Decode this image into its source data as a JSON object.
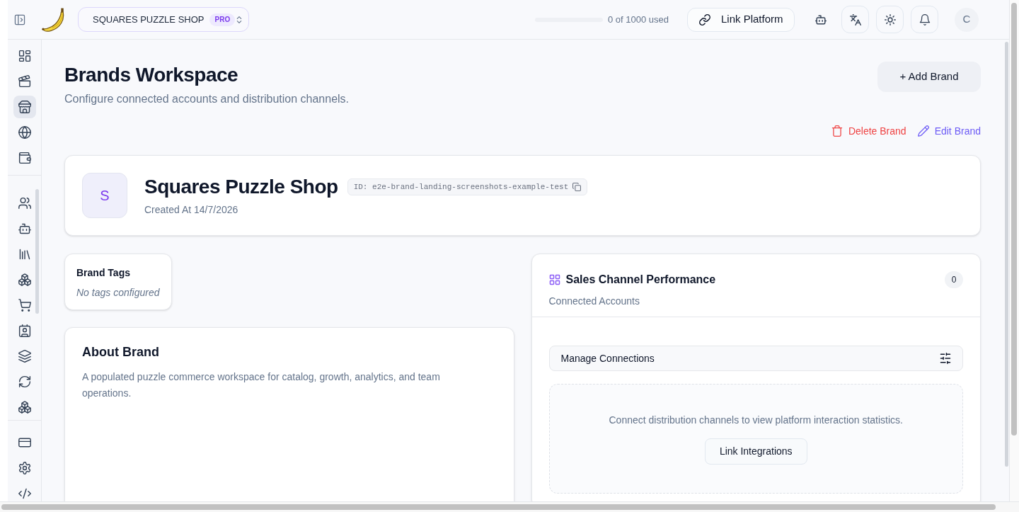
{
  "topbar": {
    "workspace": {
      "name": "SQUARES PUZZLE SHOP",
      "badge": "PRO"
    },
    "usage": {
      "level": 0,
      "text": "0 of 1000 used"
    },
    "link_button": "Link Platform",
    "avatar": "C"
  },
  "sidebar": {
    "sections": [
      {
        "items": [
          {
            "selected": false
          },
          {
            "selected": false
          },
          {
            "selected": true
          },
          {
            "selected": false
          },
          {
            "selected": false
          }
        ]
      },
      {
        "items": [
          {
            "selected": false
          },
          {
            "selected": false
          },
          {
            "selected": false
          },
          {
            "selected": false
          },
          {
            "selected": false
          },
          {
            "selected": false
          },
          {
            "selected": false
          },
          {
            "selected": false
          },
          {
            "selected": false
          }
        ]
      },
      {
        "items": [
          {
            "selected": false
          },
          {
            "selected": false
          },
          {
            "selected": false
          }
        ]
      }
    ]
  },
  "header": {
    "title": "Brands Workspace",
    "subtitle": "Configure connected accounts and distribution channels.",
    "add_button": "+ Add Brand"
  },
  "actions": [
    {
      "kind": "delete",
      "label": "Delete Brand"
    },
    {
      "kind": "edit",
      "label": "Edit Brand"
    }
  ],
  "brand": {
    "initial": "S",
    "name": "Squares Puzzle Shop",
    "id": "ID: e2e-brand-landing-screenshots-example-test",
    "created": "Created At 14/7/2026"
  },
  "tags": {
    "title": "Brand Tags",
    "empty_text": "No tags configured"
  },
  "about": {
    "title": "About Brand",
    "text": "A populated puzzle commerce workspace for catalog, growth, analytics, and team operations."
  },
  "sales": {
    "title": "Sales Channel Performance",
    "count": "0",
    "subtitle": "Connected Accounts",
    "manage_label": "Manage Connections",
    "empty_text": "Connect distribution channels to view platform interaction statistics.",
    "button": "Link Integrations"
  }
}
